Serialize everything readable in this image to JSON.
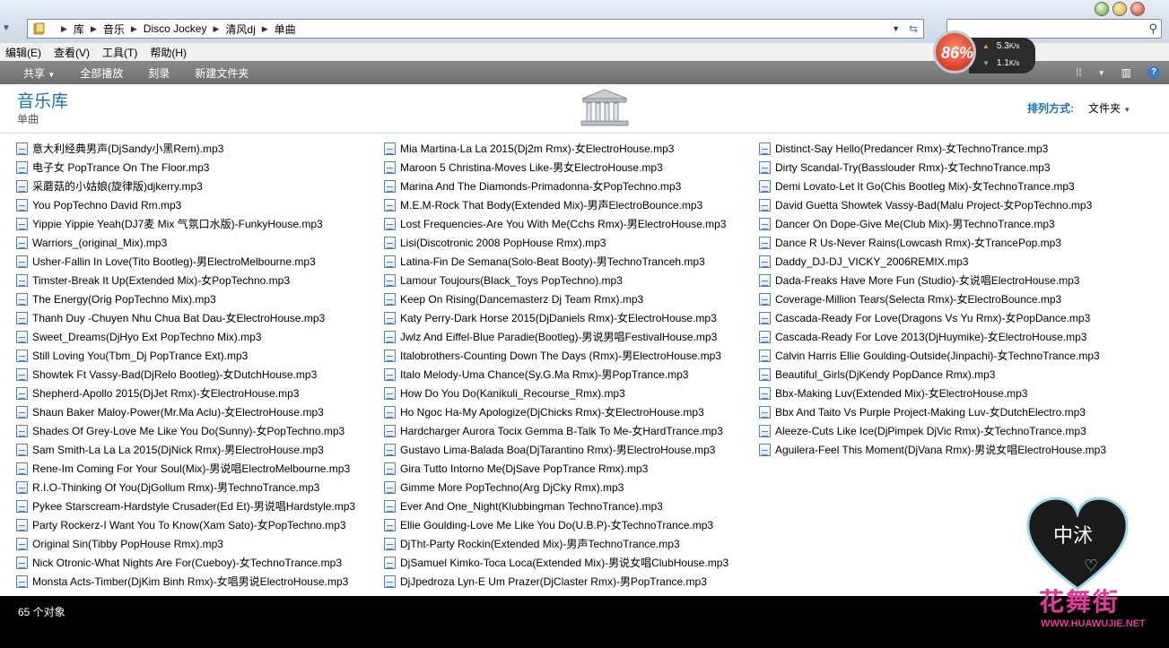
{
  "address": {
    "crumbs": [
      "库",
      "音乐",
      "Disco Jockey",
      "清风dj",
      "单曲"
    ]
  },
  "menu": [
    "编辑(E)",
    "查看(V)",
    "工具(T)",
    "帮助(H)"
  ],
  "toolbar": {
    "share": "共享",
    "play_all": "全部播放",
    "burn": "刻录",
    "new_folder": "新建文件夹"
  },
  "net": {
    "percent": "86%",
    "up": "5.3",
    "down": "1.1",
    "unit": "K/s"
  },
  "library": {
    "title": "音乐库",
    "subtitle": "单曲",
    "arrange_label": "排列方式:",
    "arrange_value": "文件夹"
  },
  "files": [
    [
      "意大利经典男声(DjSandy小黑Rem).mp3",
      "电子女 PopTrance On The Floor.mp3",
      "采蘑菇的小姑娘(旋律版)djkerry.mp3",
      "You PopTechno David Rm.mp3",
      "Yippie Yippie Yeah(DJ7麦 Mix 气氛口水版)-FunkyHouse.mp3",
      "Warriors_(original_Mix).mp3",
      "Usher-Fallin In Love(Tito Bootleg)-男ElectroMelbourne.mp3",
      "Timster-Break It Up(Extended Mix)-女PopTechno.mp3",
      "The Energy(Orig PopTechno Mix).mp3",
      "Thanh Duy -Chuyen Nhu Chua Bat Dau-女ElectroHouse.mp3",
      "Sweet_Dreams(DjHyo Ext PopTechno Mix).mp3",
      "Still Loving You(Tbm_Dj PopTrance Ext).mp3",
      "Showtek Ft Vassy-Bad(DjRelo Bootleg)-女DutchHouse.mp3",
      "Shepherd-Apollo 2015(DjJet Rmx)-女ElectroHouse.mp3",
      "Shaun Baker Maloy-Power(Mr.Ma Aclu)-女ElectroHouse.mp3",
      "Shades Of Grey-Love Me Like You Do(Sunny)-女PopTechno.mp3",
      "Sam Smith-La La La 2015(DjNick Rmx)-男ElectroHouse.mp3",
      "Rene-Im Coming For Your Soul(Mix)-男说唱ElectroMelbourne.mp3",
      "R.I.O-Thinking Of You(DjGollum Rmx)-男TechnoTrance.mp3",
      "Pykee Starscream-Hardstyle Crusader(Ed Et)-男说唱Hardstyle.mp3",
      "Party Rockerz-I Want You To Know(Xam Sato)-女PopTechno.mp3",
      "Original Sin(Tibby PopHouse Rmx).mp3",
      "Nick Otronic-What Nights Are For(Cueboy)-女TechnoTrance.mp3",
      "Monsta Acts-Timber(DjKim Binh Rmx)-女唱男说ElectroHouse.mp3"
    ],
    [
      "Mia Martina-La La 2015(Dj2m Rmx)-女ElectroHouse.mp3",
      "Maroon 5 Christina-Moves Like-男女ElectroHouse.mp3",
      "Marina And The Diamonds-Primadonna-女PopTechno.mp3",
      "M.E.M-Rock That Body(Extended Mix)-男声ElectroBounce.mp3",
      "Lost Frequencies-Are You With Me(Cchs Rmx)-男ElectroHouse.mp3",
      "Lisi(Discotronic 2008 PopHouse Rmx).mp3",
      "Latina-Fin De Semana(Solo-Beat Booty)-男TechnoTranceh.mp3",
      "Lamour Toujours(Black_Toys PopTechno).mp3",
      "Keep On Rising(Dancemasterz Dj Team Rmx).mp3",
      "Katy Perry-Dark Horse 2015(DjDaniels Rmx)-女ElectroHouse.mp3",
      "Jwlz And Eiffel-Blue Paradie(Bootleg)-男说男唱FestivalHouse.mp3",
      "Italobrothers-Counting Down The Days (Rmx)-男ElectroHouse.mp3",
      "Italo Melody-Uma Chance(Sy.G.Ma Rmx)-男PopTrance.mp3",
      "How Do You Do(Kanikuli_Recourse_Rmx).mp3",
      "Ho Ngoc Ha-My Apologize(DjChicks Rmx)-女ElectroHouse.mp3",
      "Hardcharger Aurora Tocix Gemma B-Talk To Me-女HardTrance.mp3",
      "Gustavo Lima-Balada Boa(DjTarantino Rmx)-男ElectroHouse.mp3",
      "Gira Tutto Intorno Me(DjSave PopTrance Rmx).mp3",
      "Gimme More PopTechno(Arg DjCky Rmx).mp3",
      "Ever And One_Night(Klubbingman TechnoTrance).mp3",
      "Ellie Goulding-Love Me Like You Do(U.B.P)-女TechnoTrance.mp3",
      "DjTht-Party Rockin(Extended Mix)-男声TechnoTrance.mp3",
      "DjSamuel Kimko-Toca Loca(Extended Mix)-男说女唱ClubHouse.mp3",
      "DjJpedroza Lyn-E Um Prazer(DjClaster Rmx)-男PopTrance.mp3"
    ],
    [
      "Distinct-Say Hello(Predancer Rmx)-女TechnoTrance.mp3",
      "Dirty Scandal-Try(Basslouder Rmx)-女TechnoTrance.mp3",
      "Demi Lovato-Let It Go(Chis Bootleg Mix)-女TechnoTrance.mp3",
      "David Guetta Showtek Vassy-Bad(Malu Project-女PopTechno.mp3",
      "Dancer On Dope-Give Me(Club Mix)-男TechnoTrance.mp3",
      "Dance R Us-Never Rains(Lowcash Rmx)-女TrancePop.mp3",
      "Daddy_DJ-DJ_VICKY_2006REMIX.mp3",
      "Dada-Freaks Have More Fun (Studio)-女说唱ElectroHouse.mp3",
      "Coverage-Million Tears(Selecta Rmx)-女ElectroBounce.mp3",
      "Cascada-Ready For Love(Dragons Vs Yu Rmx)-女PopDance.mp3",
      "Cascada-Ready For Love 2013(DjHuymike)-女ElectroHouse.mp3",
      "Calvin Harris Ellie Goulding-Outside(Jinpachi)-女TechnoTrance.mp3",
      "Beautiful_Girls(DjKendy PopDance Rmx).mp3",
      "Bbx-Making Luv(Extended Mix)-女ElectroHouse.mp3",
      "Bbx And Taito Vs Purple Project-Making Luv-女DutchElectro.mp3",
      "Aleeze-Cuts Like Ice(DjPimpek DjVic Rmx)-女TechnoTrance.mp3",
      "Aguilera-Feel This Moment(DjVana Rmx)-男说女唱ElectroHouse.mp3"
    ]
  ],
  "status": {
    "count": "65 个对象"
  },
  "watermark": {
    "heart_text": "中沭",
    "site_text": "花舞街",
    "url": "WWW.HUAWUJIE.NET"
  },
  "colors": {
    "accent": "#1e6fb8",
    "toolbar": "#7a7a7a",
    "statusbar": "#000000",
    "watermark": "#e23a9a"
  }
}
